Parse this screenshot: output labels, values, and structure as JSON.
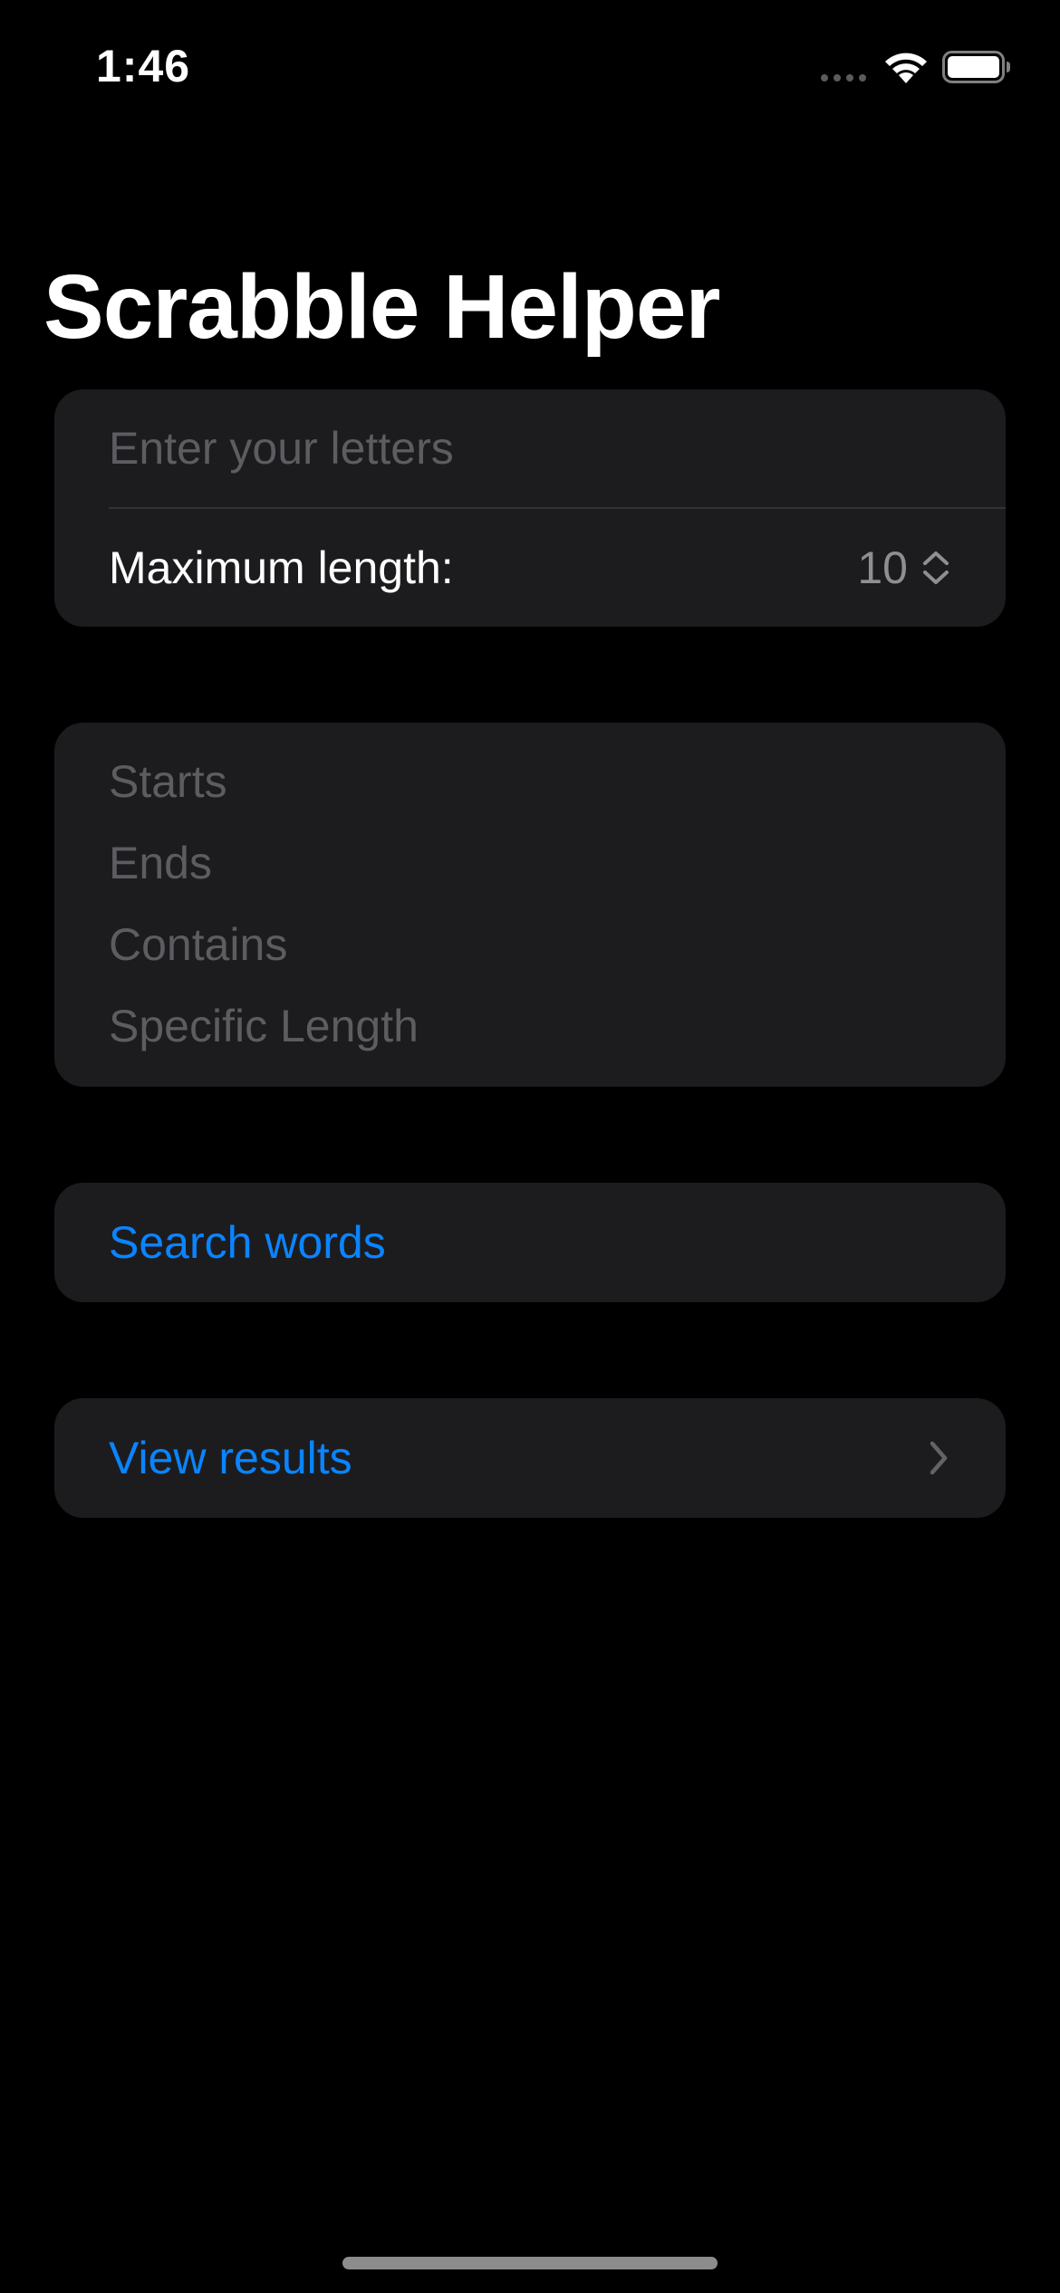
{
  "status_bar": {
    "time": "1:46"
  },
  "title": "Scrabble Helper",
  "letters_input": {
    "placeholder": "Enter your letters",
    "value": ""
  },
  "max_length": {
    "label": "Maximum length:",
    "value": "10"
  },
  "filters": [
    {
      "label": "Starts"
    },
    {
      "label": "Ends"
    },
    {
      "label": "Contains"
    },
    {
      "label": "Specific Length"
    }
  ],
  "search_button": {
    "label": "Search words"
  },
  "results_link": {
    "label": "View results"
  },
  "colors": {
    "background": "#000000",
    "card": "#1c1c1e",
    "accent": "#0a84ff",
    "placeholder": "#5c5c61",
    "secondary": "#8e8e93"
  },
  "icons": [
    "cellular-signal-icon",
    "wifi-icon",
    "battery-icon",
    "chevron-up-down-icon",
    "chevron-right-icon"
  ]
}
